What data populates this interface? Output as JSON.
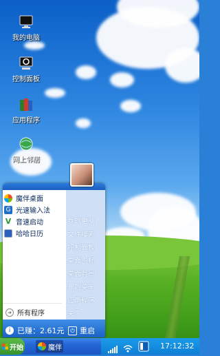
{
  "desktop": {
    "icons": [
      {
        "label": "我的电脑",
        "icon": "computer-icon"
      },
      {
        "label": "控制面板",
        "icon": "control-panel-icon"
      },
      {
        "label": "应用程序",
        "icon": "applications-icon"
      },
      {
        "label": "网上邻居",
        "icon": "network-icon"
      }
    ]
  },
  "start_menu": {
    "apps": [
      {
        "label": "魔伴桌面",
        "icon": "pinwheel-icon"
      },
      {
        "label": "光速输入法",
        "icon": "input-method-icon"
      },
      {
        "label": "音速启动",
        "icon": "launcher-v-icon"
      },
      {
        "label": "哈哈日历",
        "icon": "calendar-icon"
      }
    ],
    "right_links": [
      "我的电脑",
      "文件搜索",
      "控制面板",
      "桌面图标",
      "桌面背景",
      "开始菜单",
      "应用程序",
      "关于"
    ],
    "all_programs": "所有程序",
    "earned": "已赚：2.61元",
    "restart": "重启"
  },
  "taskbar": {
    "start_label": "开始",
    "task_label": "魔伴",
    "clock": "17:12:32"
  }
}
